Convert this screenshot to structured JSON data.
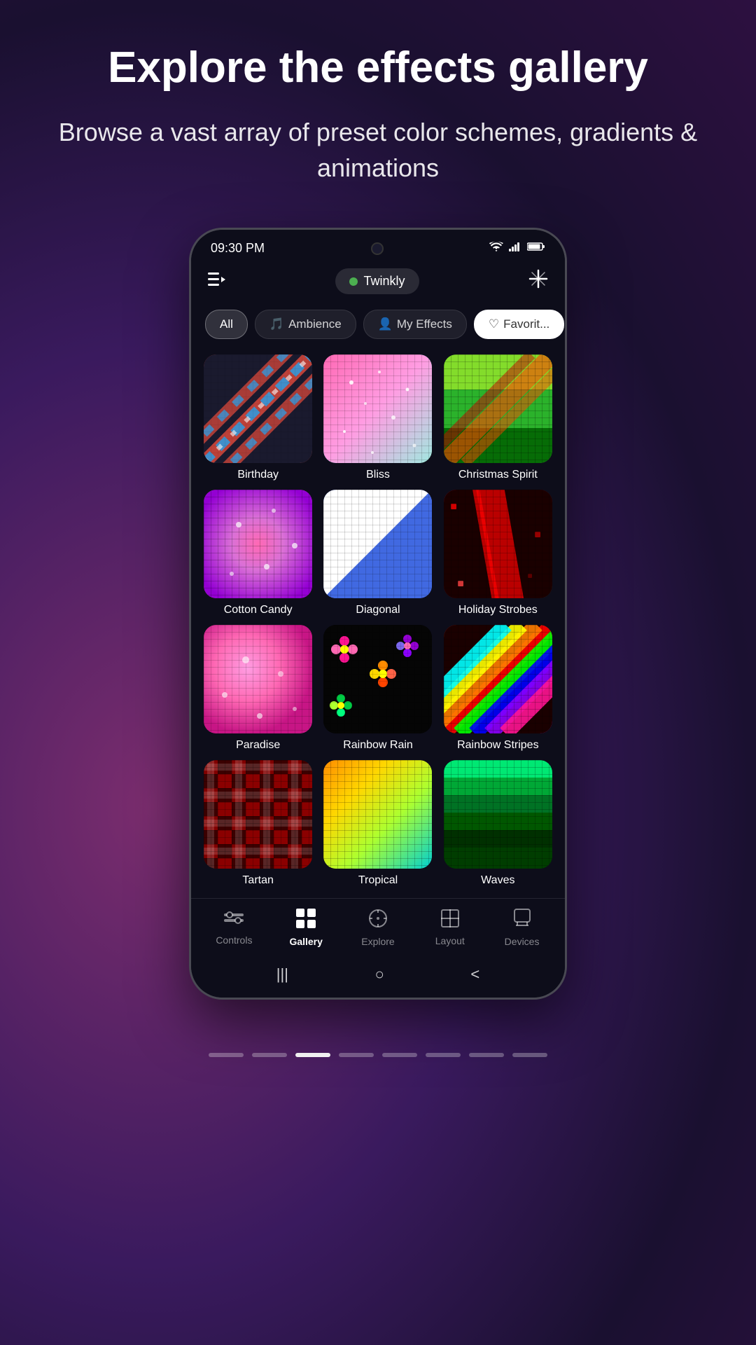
{
  "header": {
    "title": "Explore the effects gallery",
    "subtitle": "Browse a vast array of preset color schemes, gradients & animations"
  },
  "status_bar": {
    "time": "09:30 PM",
    "wifi_icon": "wifi",
    "signal_icon": "signal",
    "battery_icon": "battery"
  },
  "top_bar": {
    "playlist_icon": "playlist",
    "brand_name": "Twinkly",
    "connected_dot_color": "#4caf50",
    "sparkle_icon": "sparkle"
  },
  "filter_tabs": [
    {
      "label": "All",
      "state": "active"
    },
    {
      "label": "Ambience",
      "state": "inactive",
      "icon": "ambience"
    },
    {
      "label": "My Effects",
      "state": "inactive",
      "icon": "person"
    },
    {
      "label": "Favorit...",
      "state": "white",
      "icon": "heart"
    }
  ],
  "effects": [
    {
      "name": "Birthday",
      "thumb_class": "thumb-birthday"
    },
    {
      "name": "Bliss",
      "thumb_class": "thumb-bliss"
    },
    {
      "name": "Christmas Spirit",
      "thumb_class": "thumb-christmas"
    },
    {
      "name": "Cotton Candy",
      "thumb_class": "thumb-cotton-candy"
    },
    {
      "name": "Diagonal",
      "thumb_class": "thumb-diagonal"
    },
    {
      "name": "Holiday Strobes",
      "thumb_class": "thumb-holiday"
    },
    {
      "name": "Paradise",
      "thumb_class": "thumb-paradise"
    },
    {
      "name": "Rainbow Rain",
      "thumb_class": "thumb-rainbow-rain"
    },
    {
      "name": "Rainbow Stripes",
      "thumb_class": "thumb-rainbow-stripes"
    },
    {
      "name": "Tartan",
      "thumb_class": "thumb-tartan"
    },
    {
      "name": "Tropical",
      "thumb_class": "thumb-tropical"
    },
    {
      "name": "Waves",
      "thumb_class": "thumb-waves"
    }
  ],
  "bottom_nav": [
    {
      "label": "Controls",
      "icon": "⊞",
      "active": false
    },
    {
      "label": "Gallery",
      "icon": "⊟",
      "active": true
    },
    {
      "label": "Explore",
      "icon": "◎",
      "active": false
    },
    {
      "label": "Layout",
      "icon": "#",
      "active": false
    },
    {
      "label": "Devices",
      "icon": "⊓",
      "active": false
    }
  ],
  "android_nav": {
    "recent_icon": "|||",
    "home_icon": "○",
    "back_icon": "<"
  },
  "page_indicators": {
    "total": 8,
    "active_index": 2
  }
}
